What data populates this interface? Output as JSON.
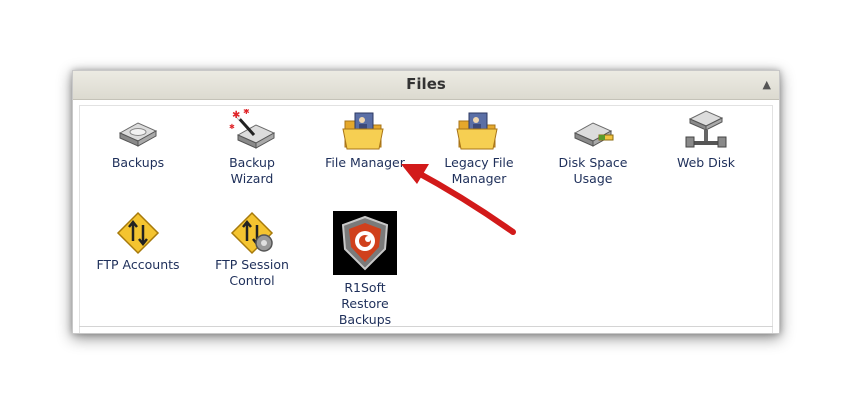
{
  "panel": {
    "title": "Files",
    "collapse_glyph": "▲"
  },
  "items": [
    {
      "label": "Backups",
      "icon": "backups-icon"
    },
    {
      "label": "Backup\nWizard",
      "icon": "backup-wizard-icon"
    },
    {
      "label": "File Manager",
      "icon": "file-manager-icon"
    },
    {
      "label": "Legacy File\nManager",
      "icon": "legacy-file-manager-icon"
    },
    {
      "label": "Disk Space\nUsage",
      "icon": "disk-space-usage-icon"
    },
    {
      "label": "Web Disk",
      "icon": "web-disk-icon"
    },
    {
      "label": "FTP Accounts",
      "icon": "ftp-accounts-icon"
    },
    {
      "label": "FTP Session\nControl",
      "icon": "ftp-session-control-icon"
    },
    {
      "label": "R1Soft\nRestore\nBackups",
      "icon": "r1soft-restore-backups-icon"
    }
  ],
  "annotation": {
    "arrow_color": "#d21a1a",
    "icon": "red-arrow-icon"
  },
  "colors": {
    "link_text": "#1e2f5a",
    "header_bg": "#e4e2d9",
    "folder": "#f2c441"
  }
}
